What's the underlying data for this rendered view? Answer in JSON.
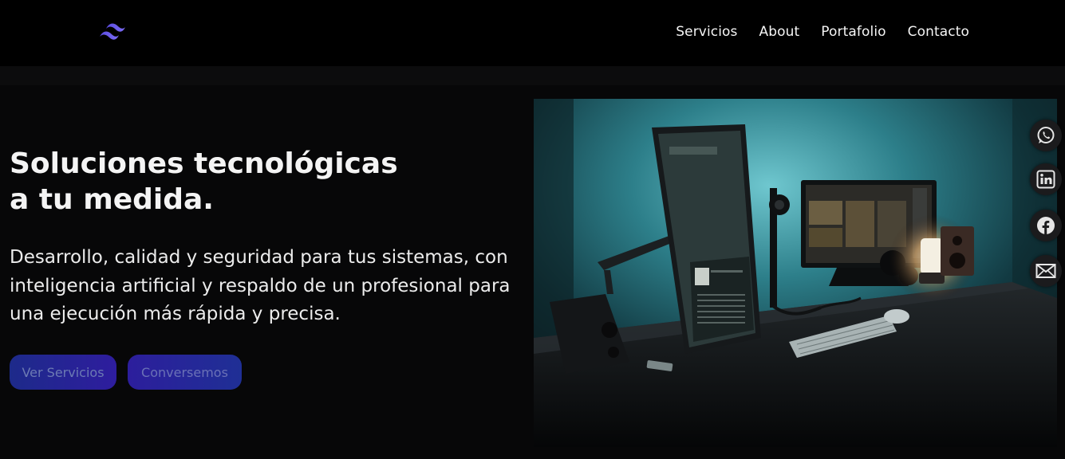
{
  "nav": {
    "logo_icon": "tailwind-wave-logo",
    "links": [
      {
        "label": "Servicios"
      },
      {
        "label": "About"
      },
      {
        "label": "Portafolio"
      },
      {
        "label": "Contacto"
      }
    ]
  },
  "hero": {
    "title_line1": "Soluciones tecnológicas",
    "title_line2": "a tu medida.",
    "description": "Desarrollo, calidad y seguridad para tus sistemas, con inteligencia artificial y respaldo de un profesional para una ejecución más rápida y precisa.",
    "primary_button": "Ver Servicios",
    "secondary_button": "Conversemos",
    "image_subject": "desk-setup-monitors-photo"
  },
  "social": [
    {
      "icon": "whatsapp-icon"
    },
    {
      "icon": "linkedin-icon"
    },
    {
      "icon": "facebook-icon"
    },
    {
      "icon": "email-icon"
    }
  ],
  "colors": {
    "background": "#070708",
    "navbar": "#000000",
    "logo_accent": "#6b5cf0",
    "button_gradient_start": "#1d2a8a",
    "button_gradient_end": "#2e1d9e"
  }
}
